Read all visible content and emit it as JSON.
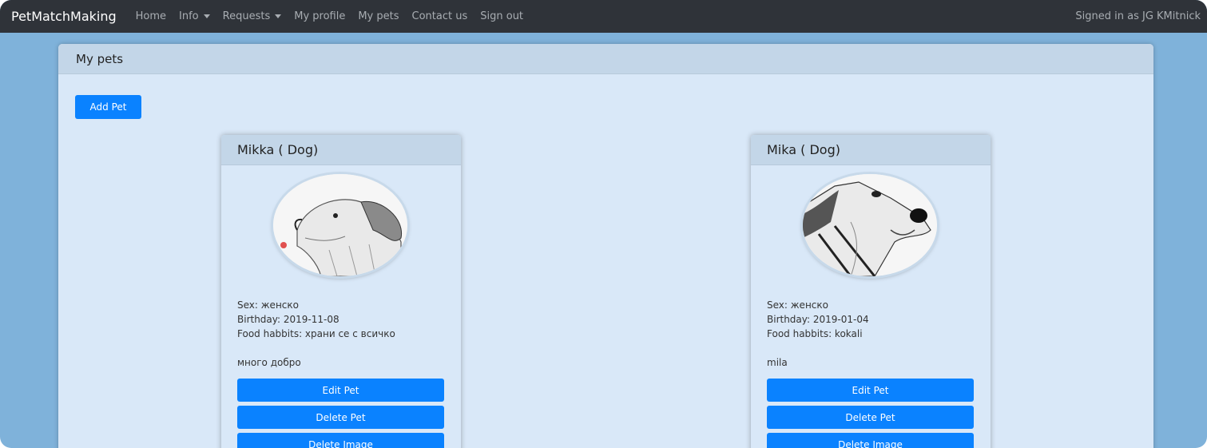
{
  "navbar": {
    "brand": "PetMatchMaking",
    "links": [
      "Home",
      "Info",
      "Requests",
      "My profile",
      "My pets",
      "Contact us",
      "Sign out"
    ],
    "signed_in": "Signed in as JG KMitnick"
  },
  "page": {
    "title": "My pets",
    "add_button": "Add Pet"
  },
  "pets": [
    {
      "name": "Mikka ( Dog)",
      "sex": "Sex: женско",
      "birthday": "Birthday: 2019-11-08",
      "food": "Food habbits: храни се с всичко",
      "description": "много добро",
      "edit": "Edit Pet",
      "delete": "Delete Pet",
      "delete_image": "Delete Image"
    },
    {
      "name": "Mika ( Dog)",
      "sex": "Sex: женско",
      "birthday": "Birthday: 2019-01-04",
      "food": "Food habbits: kokali",
      "description": "mila",
      "edit": "Edit Pet",
      "delete": "Delete Pet",
      "delete_image": "Delete Image"
    }
  ],
  "colors": {
    "navbar": "#2f3339",
    "page_background": "#7fb2da",
    "card": "#d9e8f8",
    "card_header": "#c3d6e8",
    "primary_button": "#0a82ff"
  }
}
